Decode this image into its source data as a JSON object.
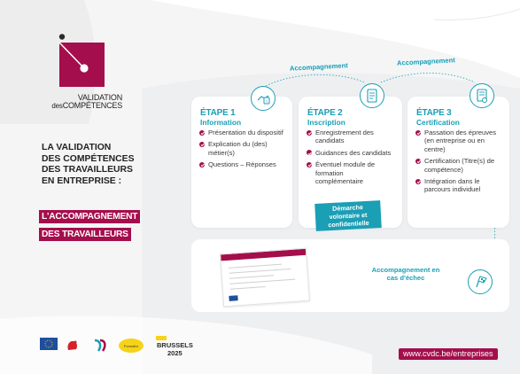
{
  "logo": {
    "line1": "VALIDATION",
    "line2_prefix": "des",
    "line2_main": "COMPÉTENCES"
  },
  "headline": {
    "lines": [
      "LA VALIDATION",
      "DES COMPÉTENCES",
      "DES TRAVAILLEURS",
      "EN ENTREPRISE :"
    ],
    "badge_1": "L'ACCOMPAGNEMENT",
    "badge_2": "DES TRAVAILLEURS"
  },
  "flow": {
    "accompagnement_1": "Accompagnement",
    "accompagnement_2": "Accompagnement"
  },
  "steps": [
    {
      "title": "ÉTAPE 1",
      "subtitle": "Information",
      "items": [
        "Présentation du dispositif",
        "Explication du (des) métier(s)",
        "Questions – Réponses"
      ]
    },
    {
      "title": "ÉTAPE 2",
      "subtitle": "Inscription",
      "items": [
        "Enregistrement des candidats",
        "Guidances des candidats",
        "Éventuel module de formation complémentaire"
      ],
      "badge": "Démarche volontaire et confidentielle"
    },
    {
      "title": "ÉTAPE 3",
      "subtitle": "Certification",
      "items": [
        "Passation des épreuves (en entreprise ou en centre)",
        "Certification (Titre(s) de compétence)",
        "Intégration dans le parcours individuel"
      ]
    }
  ],
  "failure": {
    "label": "Accompagnement en cas d'échec"
  },
  "footer": {
    "website": "www.cvdc.be/entreprises",
    "logo_bruxelles": "BRUSSELS",
    "logo_year": "2025"
  },
  "colors": {
    "brand_magenta": "#a40e4c",
    "accent_teal": "#1a9fb5"
  },
  "icons": [
    "hand-info-icon",
    "document-check-icon",
    "certificate-icon",
    "flag-icon"
  ]
}
